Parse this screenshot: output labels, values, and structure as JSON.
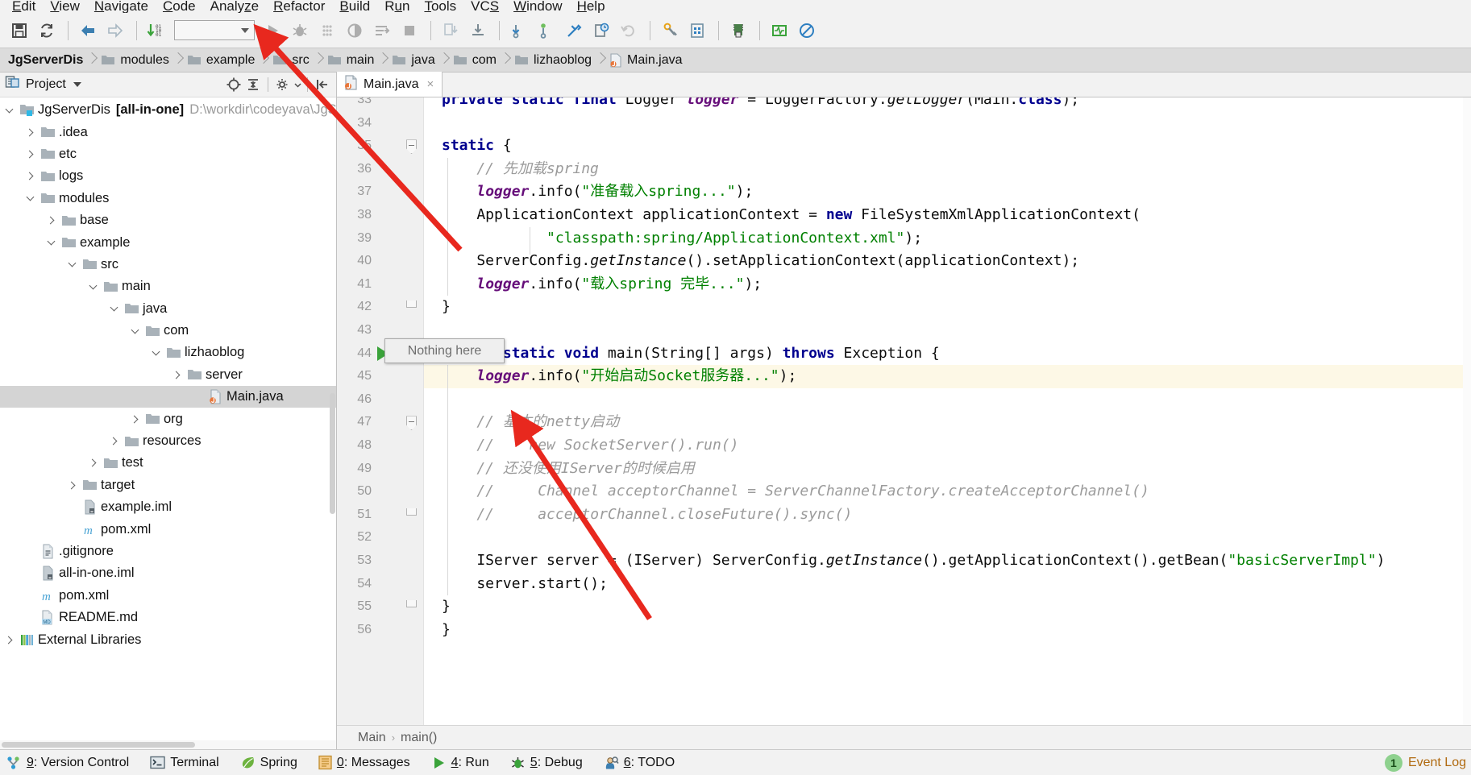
{
  "menu": {
    "items": [
      {
        "label": "Edit",
        "accel": "E"
      },
      {
        "label": "View",
        "accel": "V"
      },
      {
        "label": "Navigate",
        "accel": "N"
      },
      {
        "label": "Code",
        "accel": "C"
      },
      {
        "label": "Analyze",
        "accel": "z"
      },
      {
        "label": "Refactor",
        "accel": "R"
      },
      {
        "label": "Build",
        "accel": "B"
      },
      {
        "label": "Run",
        "accel": "u"
      },
      {
        "label": "Tools",
        "accel": "T"
      },
      {
        "label": "VCS",
        "accel": "S"
      },
      {
        "label": "Window",
        "accel": "W"
      },
      {
        "label": "Help",
        "accel": "H"
      }
    ]
  },
  "toolbar": {
    "buttons": [
      {
        "name": "save-all-icon",
        "title": "Save All"
      },
      {
        "name": "sync-refresh-icon",
        "title": "Synchronize"
      },
      {
        "name": "back-arrow-icon",
        "title": "Back"
      },
      {
        "name": "forward-arrow-icon",
        "title": "Forward"
      },
      {
        "name": "compile-icon",
        "title": "Compile"
      },
      {
        "name": "run-icon",
        "title": "Run"
      },
      {
        "name": "debug-icon",
        "title": "Debug"
      },
      {
        "name": "run-coverage-icon",
        "title": "Run with Coverage"
      },
      {
        "name": "profile-icon",
        "title": "Profile"
      },
      {
        "name": "run-to-cursor-icon",
        "title": "Run Dashboard"
      },
      {
        "name": "stop-icon",
        "title": "Stop"
      },
      {
        "name": "update-project-icon",
        "title": "Update Project"
      },
      {
        "name": "commit-icon",
        "title": "Commit"
      },
      {
        "name": "push-icon",
        "title": "Push"
      },
      {
        "name": "pull-icon",
        "title": "Pull"
      },
      {
        "name": "branch-icon",
        "title": "Branches"
      },
      {
        "name": "history-icon",
        "title": "Show History"
      },
      {
        "name": "revert-icon",
        "title": "Revert"
      },
      {
        "name": "settings-icon",
        "title": "Settings"
      },
      {
        "name": "project-structure-icon",
        "title": "Project Structure"
      },
      {
        "name": "sdk-manager-icon",
        "title": "SDK Manager"
      },
      {
        "name": "profiler-icon",
        "title": "Profiler"
      },
      {
        "name": "no-entry-icon",
        "title": "Disable"
      }
    ],
    "run_configuration": ""
  },
  "breadcrumb": {
    "items": [
      {
        "label": "JgServerDis",
        "icon": "none"
      },
      {
        "label": "modules",
        "icon": "folder"
      },
      {
        "label": "example",
        "icon": "folder"
      },
      {
        "label": "src",
        "icon": "folder"
      },
      {
        "label": "main",
        "icon": "folder"
      },
      {
        "label": "java",
        "icon": "folder"
      },
      {
        "label": "com",
        "icon": "folder"
      },
      {
        "label": "lizhaoblog",
        "icon": "folder"
      },
      {
        "label": "Main.java",
        "icon": "java"
      }
    ]
  },
  "sidebar": {
    "title": "Project",
    "tree": [
      {
        "depth": 0,
        "arrow": "down",
        "icon": "project",
        "label": "JgServerDis",
        "bold_suffix": "[all-in-one]",
        "dim": "D:\\workdir\\codeyava\\JgS",
        "selected": false
      },
      {
        "depth": 1,
        "arrow": "right",
        "icon": "folder",
        "label": ".idea",
        "selected": false
      },
      {
        "depth": 1,
        "arrow": "right",
        "icon": "folder",
        "label": "etc",
        "selected": false
      },
      {
        "depth": 1,
        "arrow": "right",
        "icon": "folder",
        "label": "logs",
        "selected": false
      },
      {
        "depth": 1,
        "arrow": "down",
        "icon": "folder",
        "label": "modules",
        "selected": false
      },
      {
        "depth": 2,
        "arrow": "right",
        "icon": "folder",
        "label": "base",
        "selected": false
      },
      {
        "depth": 2,
        "arrow": "down",
        "icon": "folder",
        "label": "example",
        "selected": false
      },
      {
        "depth": 3,
        "arrow": "down",
        "icon": "folder",
        "label": "src",
        "selected": false
      },
      {
        "depth": 4,
        "arrow": "down",
        "icon": "folder",
        "label": "main",
        "selected": false
      },
      {
        "depth": 5,
        "arrow": "down",
        "icon": "folder",
        "label": "java",
        "selected": false
      },
      {
        "depth": 6,
        "arrow": "down",
        "icon": "folder",
        "label": "com",
        "selected": false
      },
      {
        "depth": 7,
        "arrow": "down",
        "icon": "folder",
        "label": "lizhaoblog",
        "selected": false
      },
      {
        "depth": 8,
        "arrow": "right",
        "icon": "folder",
        "label": "server",
        "selected": false
      },
      {
        "depth": 9,
        "arrow": "none",
        "icon": "java-run",
        "label": "Main.java",
        "selected": true
      },
      {
        "depth": 6,
        "arrow": "right",
        "icon": "folder",
        "label": "org",
        "selected": false
      },
      {
        "depth": 5,
        "arrow": "right",
        "icon": "folder",
        "label": "resources",
        "selected": false
      },
      {
        "depth": 4,
        "arrow": "right",
        "icon": "folder",
        "label": "test",
        "selected": false
      },
      {
        "depth": 3,
        "arrow": "right",
        "icon": "folder",
        "label": "target",
        "selected": false
      },
      {
        "depth": 3,
        "arrow": "none",
        "icon": "iml",
        "label": "example.iml",
        "selected": false
      },
      {
        "depth": 3,
        "arrow": "none",
        "icon": "maven",
        "label": "pom.xml",
        "selected": false
      },
      {
        "depth": 1,
        "arrow": "none",
        "icon": "text",
        "label": ".gitignore",
        "selected": false
      },
      {
        "depth": 1,
        "arrow": "none",
        "icon": "iml",
        "label": "all-in-one.iml",
        "selected": false
      },
      {
        "depth": 1,
        "arrow": "none",
        "icon": "maven",
        "label": "pom.xml",
        "selected": false
      },
      {
        "depth": 1,
        "arrow": "none",
        "icon": "md",
        "label": "README.md",
        "selected": false
      },
      {
        "depth": 0,
        "arrow": "right",
        "icon": "library",
        "label": "External Libraries",
        "selected": false
      }
    ]
  },
  "editor": {
    "tab": {
      "label": "Main.java",
      "close": "×"
    },
    "first_line_number": 33,
    "highlight_line": 45,
    "run_gutter_line": 44,
    "lines": [
      {
        "n": 33,
        "tokens": [
          {
            "t": "private static final ",
            "c": "kw"
          },
          {
            "t": "Logger ",
            "c": ""
          },
          {
            "t": "logger",
            "c": "fld2"
          },
          {
            "t": " = LoggerFactory.",
            "c": ""
          },
          {
            "t": "getLogger",
            "c": "mth"
          },
          {
            "t": "(Main.",
            "c": ""
          },
          {
            "t": "class",
            "c": "kw"
          },
          {
            "t": ");",
            "c": ""
          }
        ]
      },
      {
        "n": 34,
        "tokens": []
      },
      {
        "n": 35,
        "tokens": [
          {
            "t": "static ",
            "c": "kw"
          },
          {
            "t": "{",
            "c": ""
          }
        ]
      },
      {
        "n": 36,
        "tokens": [
          {
            "t": "    // 先加载spring",
            "c": "cmt"
          }
        ]
      },
      {
        "n": 37,
        "tokens": [
          {
            "t": "    ",
            "c": ""
          },
          {
            "t": "logger",
            "c": "fld2"
          },
          {
            "t": ".info(",
            "c": ""
          },
          {
            "t": "\"准备载入spring...\"",
            "c": "str"
          },
          {
            "t": ");",
            "c": ""
          }
        ]
      },
      {
        "n": 38,
        "tokens": [
          {
            "t": "    ApplicationContext applicationContext = ",
            "c": ""
          },
          {
            "t": "new",
            "c": "kw"
          },
          {
            "t": " FileSystemXmlApplicationContext(",
            "c": ""
          }
        ]
      },
      {
        "n": 39,
        "tokens": [
          {
            "t": "            ",
            "c": ""
          },
          {
            "t": "\"classpath:spring/ApplicationContext.xml\"",
            "c": "str"
          },
          {
            "t": ");",
            "c": ""
          }
        ]
      },
      {
        "n": 40,
        "tokens": [
          {
            "t": "    ServerConfig.",
            "c": ""
          },
          {
            "t": "getInstance",
            "c": "mth"
          },
          {
            "t": "().setApplicationContext(applicationContext);",
            "c": ""
          }
        ]
      },
      {
        "n": 41,
        "tokens": [
          {
            "t": "    ",
            "c": ""
          },
          {
            "t": "logger",
            "c": "fld2"
          },
          {
            "t": ".info(",
            "c": ""
          },
          {
            "t": "\"载入spring 完毕...\"",
            "c": "str"
          },
          {
            "t": ");",
            "c": ""
          }
        ]
      },
      {
        "n": 42,
        "tokens": [
          {
            "t": "}",
            "c": ""
          }
        ]
      },
      {
        "n": 43,
        "tokens": []
      },
      {
        "n": 44,
        "tokens": [
          {
            "t": "public static void ",
            "c": "kw"
          },
          {
            "t": "main(String[] args) ",
            "c": ""
          },
          {
            "t": "throws ",
            "c": "kw"
          },
          {
            "t": "Exception {",
            "c": ""
          }
        ]
      },
      {
        "n": 45,
        "tokens": [
          {
            "t": "    ",
            "c": ""
          },
          {
            "t": "logger",
            "c": "fld2"
          },
          {
            "t": ".info(",
            "c": ""
          },
          {
            "t": "\"开始启动Socket服务器...\"",
            "c": "str"
          },
          {
            "t": ");",
            "c": ""
          }
        ]
      },
      {
        "n": 46,
        "tokens": []
      },
      {
        "n": 47,
        "tokens": [
          {
            "t": "    // 基本的netty启动",
            "c": "cmt"
          }
        ]
      },
      {
        "n": 48,
        "tokens": [
          {
            "t": "    //    new SocketServer().run()",
            "c": "cmt"
          }
        ]
      },
      {
        "n": 49,
        "tokens": [
          {
            "t": "    // 还没使用IServer的时候启用",
            "c": "cmt"
          }
        ]
      },
      {
        "n": 50,
        "tokens": [
          {
            "t": "    //     Channel acceptorChannel = ServerChannelFactory.createAcceptorChannel()",
            "c": "cmt"
          }
        ]
      },
      {
        "n": 51,
        "tokens": [
          {
            "t": "    //     acceptorChannel.closeFuture().sync()",
            "c": "cmt"
          }
        ]
      },
      {
        "n": 52,
        "tokens": []
      },
      {
        "n": 53,
        "tokens": [
          {
            "t": "    IServer server = (IServer) ServerConfig.",
            "c": ""
          },
          {
            "t": "getInstance",
            "c": "mth"
          },
          {
            "t": "().getApplicationContext().getBean(",
            "c": ""
          },
          {
            "t": "\"basicServerImpl\"",
            "c": "str"
          },
          {
            "t": ")",
            "c": ""
          }
        ]
      },
      {
        "n": 54,
        "tokens": [
          {
            "t": "    server.start();",
            "c": ""
          }
        ]
      },
      {
        "n": 55,
        "tokens": [
          {
            "t": "}",
            "c": ""
          }
        ]
      },
      {
        "n": 56,
        "tokens": [
          {
            "t": "}",
            "c": ""
          }
        ]
      }
    ],
    "bottom_breadcrumb": [
      "Main",
      "main()"
    ],
    "bottom_breadcrumb_sep": "›"
  },
  "tooltip": {
    "text": "Nothing here"
  },
  "status": {
    "items": [
      {
        "key": "9",
        "label": ": Version Control",
        "icon": "version-control-icon"
      },
      {
        "key": "",
        "label": "Terminal",
        "icon": "terminal-icon"
      },
      {
        "key": "",
        "label": "Spring",
        "icon": "spring-leaf-icon"
      },
      {
        "key": "0",
        "label": ": Messages",
        "icon": "messages-icon"
      },
      {
        "key": "4",
        "label": ": Run",
        "icon": "run-green-icon"
      },
      {
        "key": "5",
        "label": ": Debug",
        "icon": "debug-bug-icon"
      },
      {
        "key": "6",
        "label": ": TODO",
        "icon": "todo-icon"
      }
    ],
    "event_log": {
      "count": "1",
      "label": "Event Log"
    }
  },
  "colors": {
    "accent_green": "#3aa33a",
    "string_green": "#008000",
    "keyword_blue": "#00008f",
    "field_purple": "#660e7a",
    "comment_gray": "#9b9b9b",
    "selection_gray": "#d4d4d4",
    "highlight_yellow": "#fdf8e6",
    "annotation_red": "#e8281e"
  }
}
